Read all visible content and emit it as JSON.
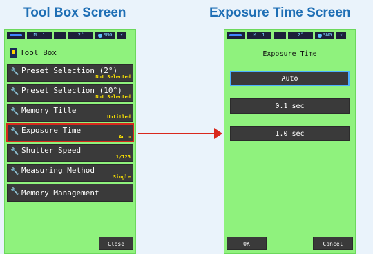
{
  "headings": {
    "left": "Tool Box Screen",
    "right": "Exposure Time Screen"
  },
  "status_bar": {
    "mode": "M",
    "memory": "1",
    "angle": "2°",
    "measure": "SNG"
  },
  "toolbox": {
    "title": "Tool Box",
    "items": [
      {
        "label": "Preset Selection (2°)",
        "value": "Not Selected"
      },
      {
        "label": "Preset Selection (10°)",
        "value": "Not Selected"
      },
      {
        "label": "Memory Title",
        "value": "Untitled"
      },
      {
        "label": "Exposure Time",
        "value": "Auto",
        "selected": true
      },
      {
        "label": "Shutter Speed",
        "value": "1/125"
      },
      {
        "label": "Measuring Method",
        "value": "Single"
      },
      {
        "label": "Memory Management",
        "value": ""
      }
    ],
    "close_label": "Close"
  },
  "exposure": {
    "title": "Exposure Time",
    "options": [
      "Auto",
      "0.1 sec",
      "1.0 sec"
    ],
    "selected": "Auto",
    "ok_label": "OK",
    "cancel_label": "Cancel"
  },
  "colors": {
    "heading": "#1f6fb5",
    "screen_bg": "#8ff27d",
    "button_bg": "#3a3a3a",
    "value_text": "#ffe600",
    "highlight": "#d9281c",
    "active_border": "#4bb0ff"
  }
}
